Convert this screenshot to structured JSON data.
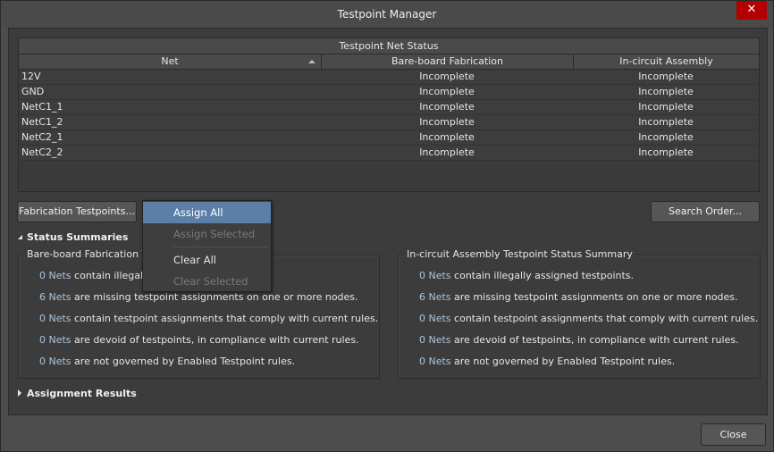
{
  "window": {
    "title": "Testpoint Manager",
    "close_icon": "close-icon"
  },
  "grid": {
    "band_title": "Testpoint Net Status",
    "columns": [
      "Net",
      "Bare-board Fabrication",
      "In-circuit Assembly"
    ],
    "sort": {
      "column": "Net",
      "direction": "ascending"
    },
    "rows": [
      {
        "net": "12V",
        "fab": "Incomplete",
        "ica": "Incomplete"
      },
      {
        "net": "GND",
        "fab": "Incomplete",
        "ica": "Incomplete"
      },
      {
        "net": "NetC1_1",
        "fab": "Incomplete",
        "ica": "Incomplete"
      },
      {
        "net": "NetC1_2",
        "fab": "Incomplete",
        "ica": "Incomplete"
      },
      {
        "net": "NetC2_1",
        "fab": "Incomplete",
        "ica": "Incomplete"
      },
      {
        "net": "NetC2_2",
        "fab": "Incomplete",
        "ica": "Incomplete"
      }
    ]
  },
  "buttons": {
    "fabrication_testpoints": "Fabrication Testpoints...",
    "search_order": "Search Order...",
    "close": "Close"
  },
  "menu": {
    "items": [
      {
        "label": "Assign All",
        "state": "highlighted"
      },
      {
        "label": "Assign Selected",
        "state": "disabled"
      },
      {
        "label": "Clear All",
        "state": "enabled"
      },
      {
        "label": "Clear Selected",
        "state": "disabled"
      }
    ]
  },
  "sections": {
    "status_summaries": "Status Summaries",
    "assignment_results": "Assignment Results"
  },
  "summaries": {
    "fabrication": {
      "title": "Bare-board Fabrication Testpoint Status Summary",
      "title_visible": "Bare-board Fabrication Te",
      "lines": [
        {
          "count": "0 Nets",
          "text": " contain illegally assigned testpoints.",
          "text_visible": " contain illegally"
        },
        {
          "count": "6 Nets",
          "text": " are missing testpoint assignments on one or more nodes."
        },
        {
          "count": "0 Nets",
          "text": " contain testpoint assignments that comply with current rules."
        },
        {
          "count": "0 Nets",
          "text": " are devoid of testpoints, in compliance with current rules."
        },
        {
          "count": "0 Nets",
          "text": " are not governed by Enabled Testpoint rules."
        }
      ]
    },
    "assembly": {
      "title": "In-circuit Assembly Testpoint Status Summary",
      "lines": [
        {
          "count": "0 Nets",
          "text": " contain illegally assigned testpoints."
        },
        {
          "count": "6 Nets",
          "text": " are missing testpoint assignments on one or more nodes."
        },
        {
          "count": "0 Nets",
          "text": " contain testpoint assignments that comply with current rules."
        },
        {
          "count": "0 Nets",
          "text": " are devoid of testpoints, in compliance with current rules."
        },
        {
          "count": "0 Nets",
          "text": " are not governed by Enabled Testpoint rules."
        }
      ]
    }
  },
  "colors": {
    "accent_highlight": "#5b7fa6",
    "count_link": "#a9c4df",
    "close_red": "#b30000"
  }
}
